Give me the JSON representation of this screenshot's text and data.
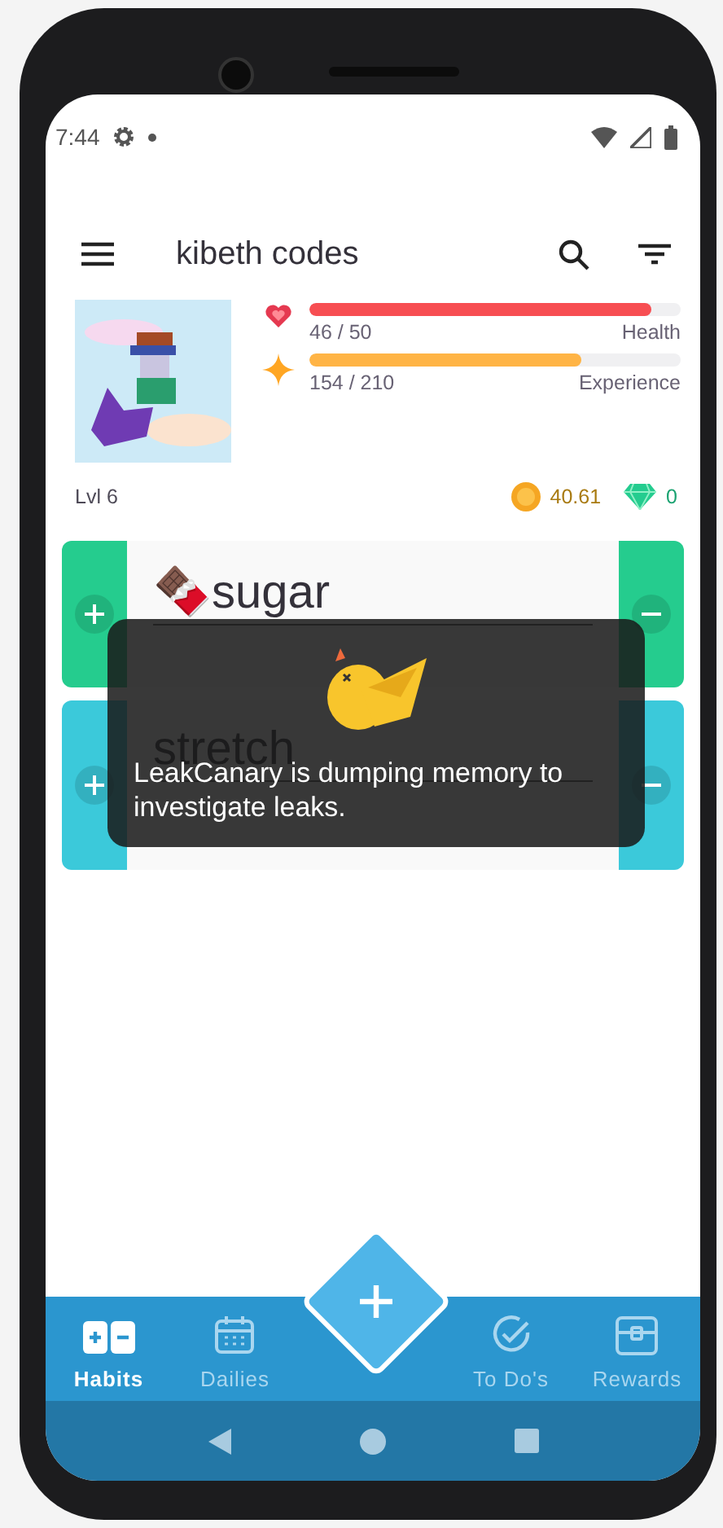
{
  "status_bar": {
    "time": "7:44"
  },
  "toolbar": {
    "title": "kibeth codes"
  },
  "stats": [
    {
      "kind": "health",
      "value": "46 / 50",
      "label": "Health",
      "level": 0.92
    },
    {
      "kind": "experience",
      "value": "154 / 210",
      "label": "Experience",
      "level": 0.733
    }
  ],
  "level": "Lvl 6",
  "gold": "40.61",
  "gems": "0",
  "habits": [
    {
      "title": "🍫sugar",
      "color": "#25cc8e"
    },
    {
      "title": "stretch",
      "color": "#3bc9da"
    }
  ],
  "toast": {
    "message": "LeakCanary is dumping memory to investigate leaks."
  },
  "bottom_nav": [
    {
      "kind": "habits",
      "label": "Habits",
      "selected": true
    },
    {
      "kind": "dailies",
      "label": "Dailies",
      "selected": false
    },
    {
      "kind": "todos",
      "label": "To Do's",
      "selected": false
    },
    {
      "kind": "rewards",
      "label": "Rewards",
      "selected": false
    }
  ]
}
